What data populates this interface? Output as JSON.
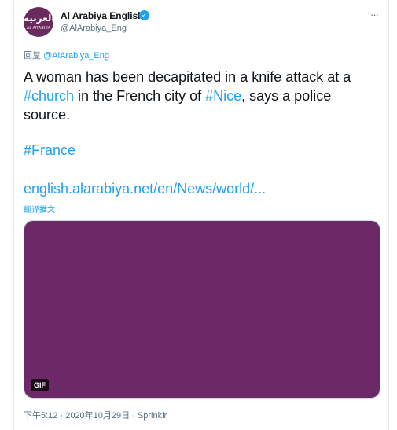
{
  "author": {
    "avatar_logo_ar": "العربية",
    "avatar_logo_en": "AL ARABIYA",
    "display_name": "Al Arabiya English",
    "verified_glyph": "✓",
    "handle": "@AlArabiya_Eng"
  },
  "more_icon": "···",
  "reply": {
    "prefix": "回复",
    "mention": "@AlArabiya_Eng"
  },
  "tweet": {
    "text_1": "A woman has been decapitated in a knife attack at a ",
    "hashtag_church": "#church",
    "text_2": " in the French city of ",
    "hashtag_nice": "#Nice",
    "text_3": ", says a police source.",
    "hashtag_france": "#France",
    "link": "english.alarabiya.net/en/News/world/...",
    "translate_label": "翻译推文"
  },
  "media": {
    "badge": "GIF",
    "color": "#6b2a67"
  },
  "meta": {
    "time": "下午5:12",
    "separator_1": " · ",
    "date": "2020年10月29日",
    "separator_2": " · ",
    "source": "Sprinklr"
  },
  "colors": {
    "accent": "#1da1f2",
    "secondary_text": "#5b7083",
    "avatar_bg": "#6b2a5e"
  }
}
